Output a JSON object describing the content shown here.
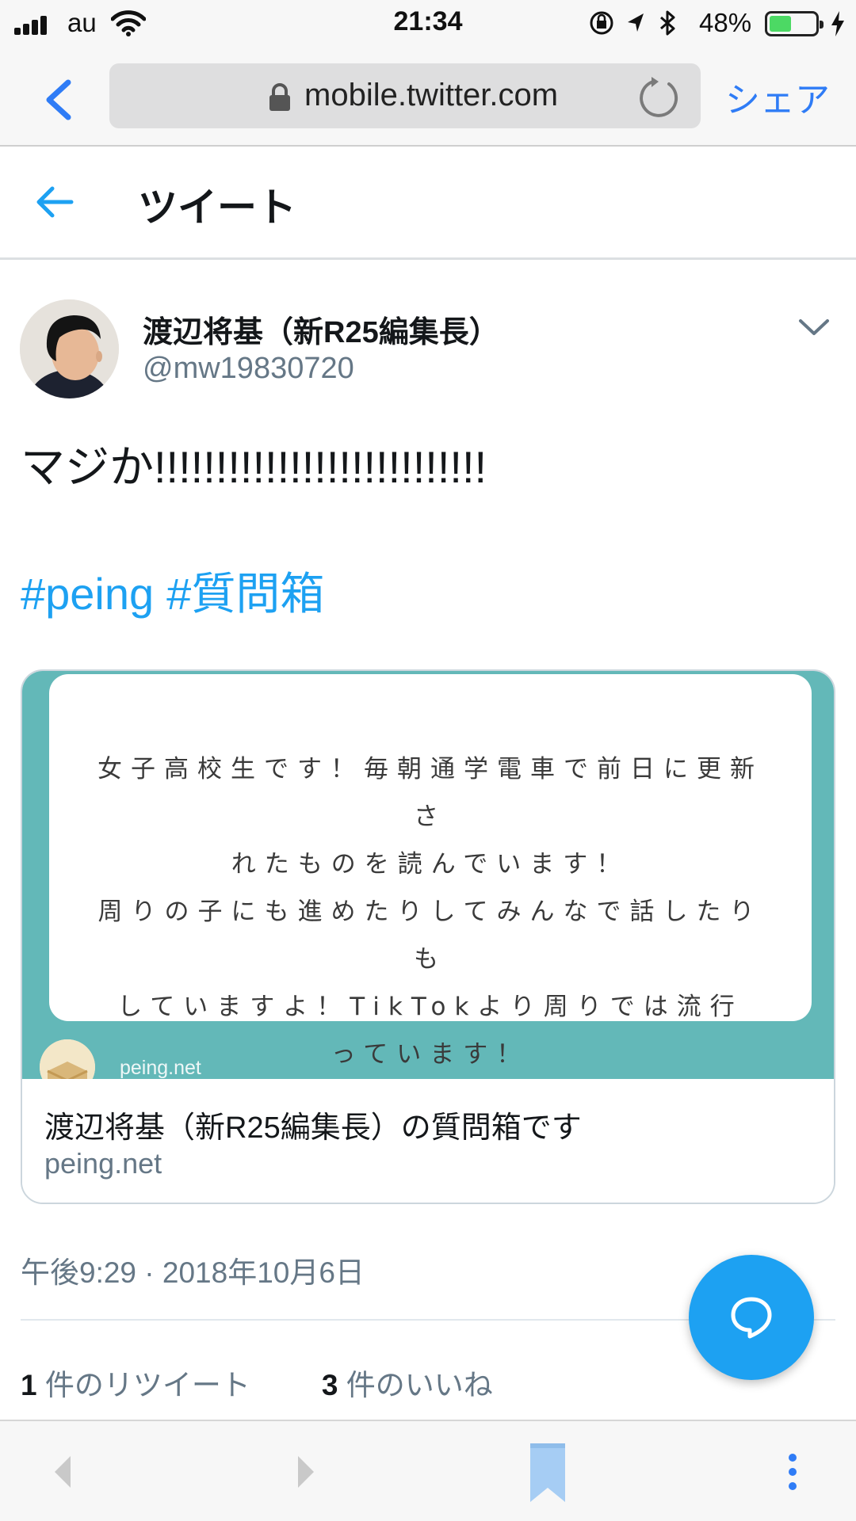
{
  "status_bar": {
    "carrier": "au",
    "time": "21:34",
    "battery_percent": "48%",
    "battery_level": 0.48,
    "icons": [
      "signal-icon",
      "wifi-icon",
      "orientation-lock-icon",
      "location-icon",
      "bluetooth-icon",
      "battery-icon",
      "charging-icon"
    ]
  },
  "browser": {
    "url": "mobile.twitter.com",
    "share_label": "シェア",
    "icons": [
      "back-chevron-icon",
      "lock-icon",
      "reload-icon"
    ]
  },
  "header": {
    "title": "ツイート",
    "back_icon": "arrow-left-icon"
  },
  "tweet": {
    "author_name": "渡辺将基（新R25編集長）",
    "author_handle": "@mw19830720",
    "text": "マジか!!!!!!!!!!!!!!!!!!!!!!!!!!!",
    "hashtags": [
      "#peing",
      "#質問箱"
    ],
    "timestamp": "午後9:29 · 2018年10月6日",
    "retweets_count": "1",
    "retweets_label": "件のリツイート",
    "likes_count": "3",
    "likes_label": "件のいいね"
  },
  "card": {
    "question": "女子高校生です！毎朝通学電車で前日に更新さ\nれたものを読んでいます！\n周りの子にも進めたりしてみんなで話したりも\nしていますよ！TikTokより周りでは流行\nっています！",
    "image_domain": "peing.net",
    "title": "渡辺将基（新R25編集長）の質問箱です",
    "domain": "peing.net"
  },
  "colors": {
    "accent": "#1da1f2",
    "ios_blue": "#2f7cf6",
    "card_teal": "#63b8b8",
    "secondary_text": "#657786"
  },
  "bottom_toolbar": {
    "icons": [
      "back-icon",
      "forward-icon",
      "bookmark-icon",
      "more-vertical-icon"
    ]
  }
}
